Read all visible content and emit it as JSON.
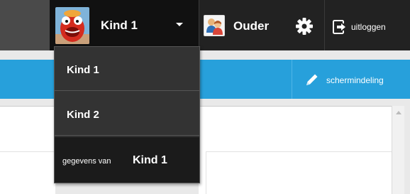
{
  "header": {
    "child_name": "Kind 1",
    "parent_label": "Ouder",
    "logout_label": "uitloggen"
  },
  "toolbar": {
    "layout_label": "schermindeling"
  },
  "dropdown": {
    "items": [
      {
        "label": "Kind 1"
      },
      {
        "label": "Kind 2"
      }
    ],
    "footer_prefix": "gegevens van",
    "footer_name": "Kind 1"
  },
  "icons": {
    "child_avatar": "muppet-avatar-icon",
    "parent_avatar": "parents-icon",
    "settings": "gear-icon",
    "logout": "logout-icon",
    "layout": "pencil-icon",
    "dropdown": "chevron-down-icon"
  },
  "colors": {
    "topbar": "#222222",
    "accent": "#27a0db",
    "dropdown_bg": "#333333"
  }
}
